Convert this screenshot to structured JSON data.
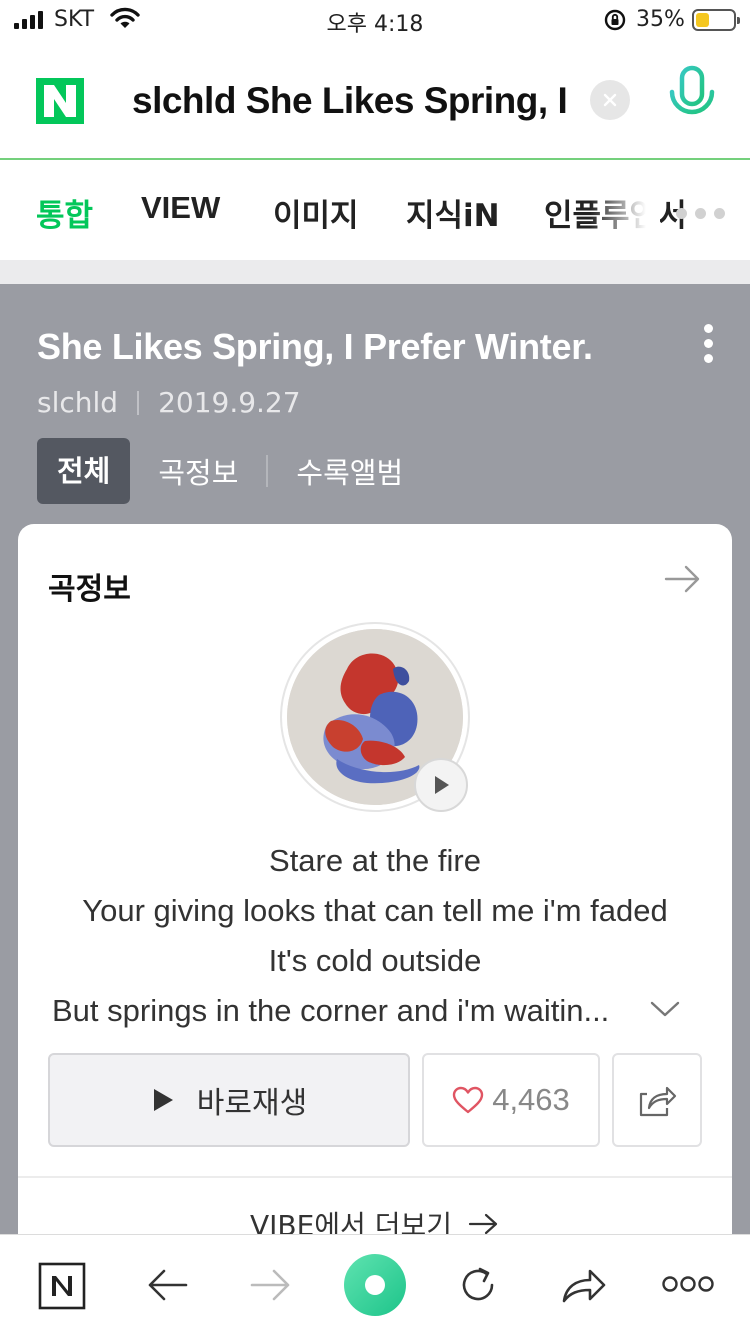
{
  "status_bar": {
    "carrier": "SKT",
    "time": "오후 4:18",
    "battery": "35%",
    "battery_level": 0.35
  },
  "search": {
    "query": "slchld She Likes Spring, I Prefer Winter.",
    "logo": "N"
  },
  "tabs": [
    {
      "label": "통합",
      "active": true
    },
    {
      "label": "VIEW"
    },
    {
      "label": "이미지"
    },
    {
      "label": "지식iN"
    },
    {
      "label": "인플루언서"
    }
  ],
  "song": {
    "title": "She Likes Spring, I Prefer Winter.",
    "artist": "slchld",
    "date": "2019.9.27"
  },
  "sub_tabs": [
    {
      "label": "전체",
      "active": true
    },
    {
      "label": "곡정보"
    },
    {
      "label": "수록앨범"
    }
  ],
  "card": {
    "title": "곡정보",
    "lyrics": [
      "Stare at the fire",
      "Your giving looks that can tell me i'm faded",
      "It's cold outside",
      "But springs in the corner and i'm waitin..."
    ],
    "play_label": "바로재생",
    "likes": "4,463",
    "vibe_label": "VIBE에서 더보기"
  },
  "colors": {
    "brand_green": "#03c75a",
    "overlay_gray": "#9a9ca3",
    "like_red": "#e05563"
  }
}
